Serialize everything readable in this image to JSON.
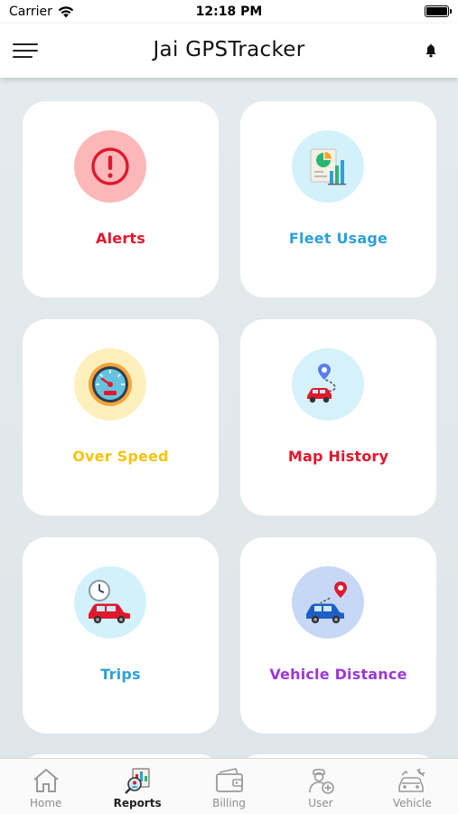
{
  "status_bar": {
    "carrier": "Carrier",
    "time": "12:18 PM",
    "battery": 1.0
  },
  "header": {
    "title": "Jai GPSTracker",
    "menu_icon": "hamburger-menu-icon",
    "notification_icon": "bell-icon"
  },
  "menu": {
    "items": [
      {
        "label": "Alerts",
        "icon": "alert-icon",
        "color": "#e0182d",
        "bg": "#fcb8b8"
      },
      {
        "label": "Fleet Usage",
        "icon": "fleet-usage-chart-icon",
        "color": "#2fa0d6",
        "bg": "#d3f1fb"
      },
      {
        "label": "Over Speed",
        "icon": "speedometer-icon",
        "color": "#f5c40c",
        "bg": "#fdf0bd"
      },
      {
        "label": "Map History",
        "icon": "route-map-car-icon",
        "color": "#e0182d",
        "bg": "#d6f1fa"
      },
      {
        "label": "Trips",
        "icon": "clock-car-icon",
        "color": "#2fa0d6",
        "bg": "#d3f1fb"
      },
      {
        "label": "Vehicle Distance",
        "icon": "pin-car-icon",
        "color": "#9b37d6",
        "bg": "#c7d8f6"
      }
    ]
  },
  "tabs": [
    {
      "label": "Home",
      "icon": "home-icon",
      "active": false
    },
    {
      "label": "Reports",
      "icon": "reports-icon",
      "active": true
    },
    {
      "label": "Billing",
      "icon": "wallet-icon",
      "active": false
    },
    {
      "label": "User",
      "icon": "add-user-icon",
      "active": false
    },
    {
      "label": "Vehicle",
      "icon": "vehicle-settings-icon",
      "active": false
    }
  ]
}
